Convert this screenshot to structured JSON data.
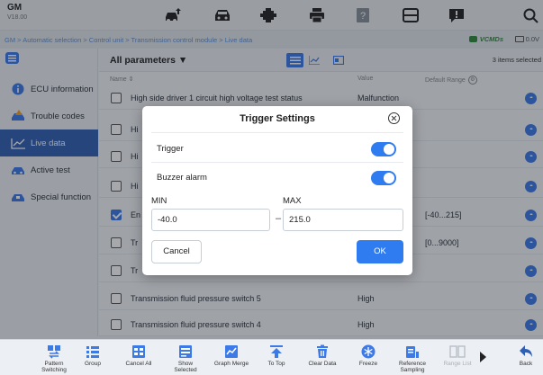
{
  "header": {
    "make": "GM",
    "version": "V18.00",
    "icons": [
      "car-upload-icon",
      "car-icon",
      "engine-icon",
      "printer-icon",
      "help-icon",
      "window-icon",
      "feedback-icon",
      "search-icon"
    ]
  },
  "breadcrumb": "GM > Automatic selection > Control unit > Transmission control module > Live data",
  "status": {
    "vci": "VCMDs",
    "voltage": "0.0V"
  },
  "sidebar": {
    "items": [
      {
        "label": "ECU information",
        "icon": "info-icon"
      },
      {
        "label": "Trouble codes",
        "icon": "car-warning-icon"
      },
      {
        "label": "Live data",
        "icon": "line-chart-icon",
        "active": true
      },
      {
        "label": "Active test",
        "icon": "car-test-icon"
      },
      {
        "label": "Special function",
        "icon": "car-function-icon"
      }
    ]
  },
  "list": {
    "selector_label": "All parameters ▼",
    "items_selected": "3 items selected",
    "columns": {
      "name": "Name ⇕",
      "value": "Value",
      "range": "Default Range"
    },
    "rows": [
      {
        "name": "High side driver 1 circuit high voltage test status",
        "value": "Malfunction",
        "range": "",
        "checked": false
      },
      {
        "name": "Hi",
        "value": "",
        "range": "",
        "checked": false
      },
      {
        "name": "Hi",
        "value": "",
        "range": "",
        "checked": false
      },
      {
        "name": "Hi",
        "value": "",
        "range": "",
        "checked": false
      },
      {
        "name": "En",
        "value": "",
        "range": "[-40...215]",
        "checked": true
      },
      {
        "name": "Tr",
        "value": "",
        "range": "[0...9000]",
        "checked": false
      },
      {
        "name": "Tr",
        "value": "",
        "range": "",
        "checked": false
      },
      {
        "name": "Transmission fluid pressure switch 5",
        "value": "High",
        "range": "",
        "checked": false
      },
      {
        "name": "Transmission fluid pressure switch 4",
        "value": "High",
        "range": "",
        "checked": false
      }
    ]
  },
  "dialog": {
    "title": "Trigger Settings",
    "trigger_label": "Trigger",
    "trigger_on": true,
    "buzzer_label": "Buzzer alarm",
    "buzzer_on": true,
    "min_label": "MIN",
    "max_label": "MAX",
    "min_value": "-40.0",
    "max_value": "215.0",
    "separator": "–",
    "cancel_label": "Cancel",
    "ok_label": "OK"
  },
  "toolbar": {
    "buttons": [
      {
        "label": "Pattern\nSwitching",
        "icon": "pattern-switch-icon"
      },
      {
        "label": "Group",
        "icon": "group-list-icon"
      },
      {
        "label": "Cancel All",
        "icon": "cancel-all-icon"
      },
      {
        "label": "Show\nSelected",
        "icon": "show-selected-icon"
      },
      {
        "label": "Graph Merge",
        "icon": "graph-merge-icon"
      },
      {
        "label": "To Top",
        "icon": "to-top-icon"
      },
      {
        "label": "Clear Data",
        "icon": "trash-icon"
      },
      {
        "label": "Freeze",
        "icon": "snowflake-icon"
      },
      {
        "label": "Reference\nSampling",
        "icon": "sampling-icon"
      },
      {
        "label": "Range List",
        "icon": "range-list-icon",
        "disabled": true
      },
      {
        "label": "Back",
        "icon": "back-arrow-icon"
      }
    ]
  },
  "colors": {
    "accent": "#2e7cf0",
    "sidebar_active": "#2f5fb4",
    "vci_green": "#2f8a3c",
    "breadcrumb": "#5a8ed8"
  }
}
